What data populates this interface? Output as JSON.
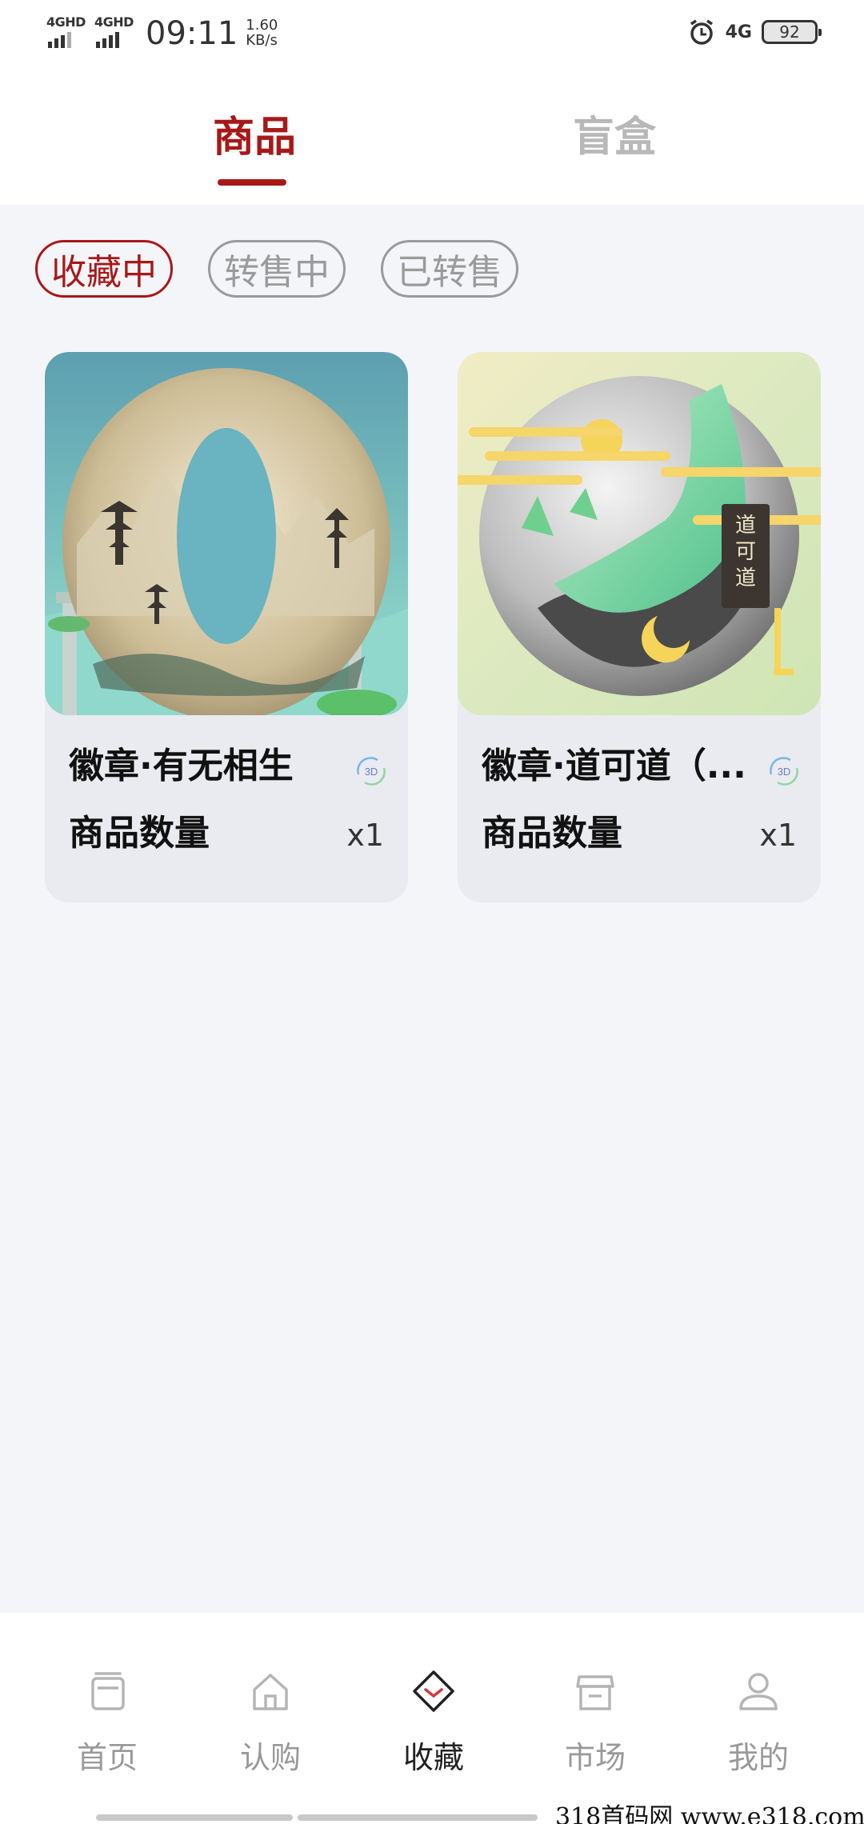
{
  "status": {
    "sim1": "4GHD",
    "sim2": "4GHD",
    "time": "09:11",
    "speed_value": "1.60",
    "speed_unit": "KB/s",
    "net": "4G",
    "battery": "92"
  },
  "tabs": {
    "goods": "商品",
    "blindbox": "盲盒"
  },
  "filters": [
    "收藏中",
    "转售中",
    "已转售"
  ],
  "items": [
    {
      "name": "徽章·有无相生",
      "qty_label": "商品数量",
      "qty": "x1",
      "badge": "3D"
    },
    {
      "name": "徽章·道可道（...",
      "qty_label": "商品数量",
      "qty": "x1",
      "badge": "3D"
    }
  ],
  "nav": [
    {
      "label": "首页",
      "icon": "home-cards-icon"
    },
    {
      "label": "认购",
      "icon": "house-icon"
    },
    {
      "label": "收藏",
      "icon": "collect-icon"
    },
    {
      "label": "市场",
      "icon": "store-icon"
    },
    {
      "label": "我的",
      "icon": "profile-icon"
    }
  ],
  "watermark": "318首码网  www.e318.com",
  "colors": {
    "accent": "#a81818",
    "inactive": "#999999",
    "background": "#f4f5f9"
  }
}
